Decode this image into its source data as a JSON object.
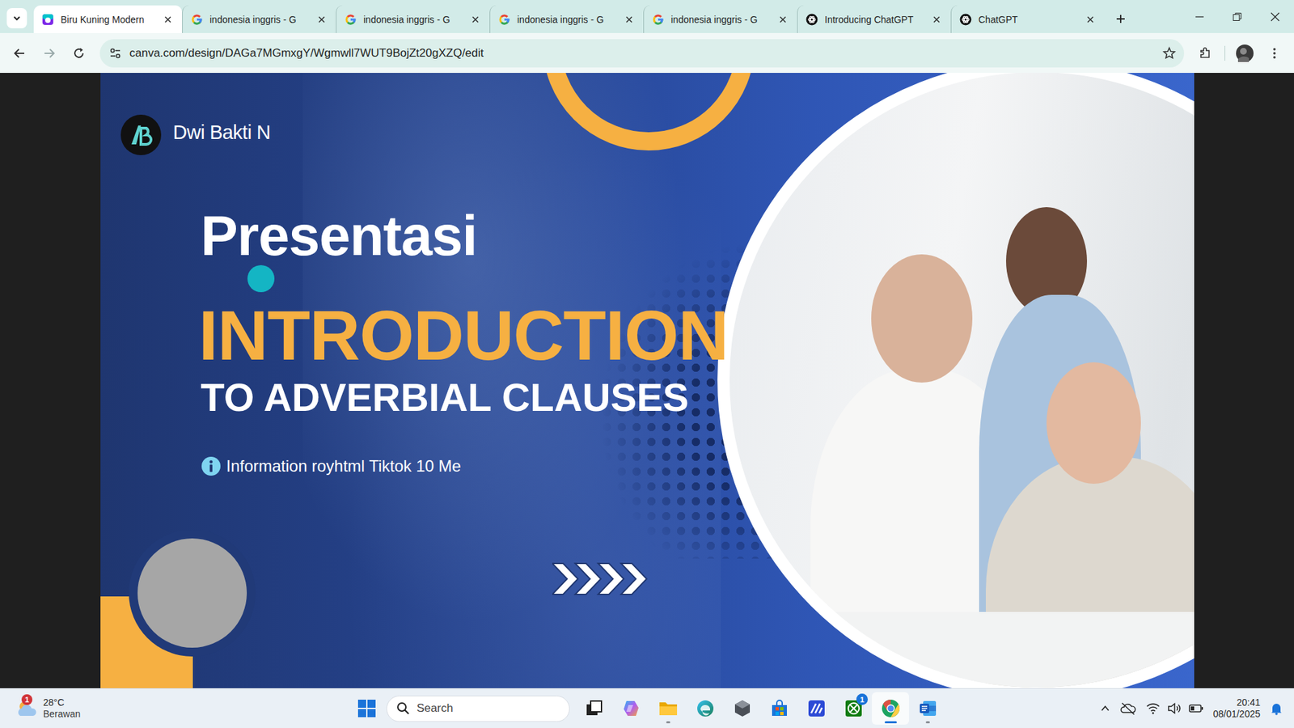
{
  "browser": {
    "tabs": [
      {
        "label": "Biru Kuning Modern",
        "selected": true,
        "kind": "canva"
      },
      {
        "label": "indonesia inggris - G",
        "selected": false,
        "kind": "google"
      },
      {
        "label": "indonesia inggris - G",
        "selected": false,
        "kind": "google"
      },
      {
        "label": "indonesia inggris - G",
        "selected": false,
        "kind": "google"
      },
      {
        "label": "indonesia inggris - G",
        "selected": false,
        "kind": "google"
      },
      {
        "label": "Introducing ChatGPT",
        "selected": false,
        "kind": "openai"
      },
      {
        "label": "ChatGPT",
        "selected": false,
        "kind": "openai"
      }
    ],
    "address": "canva.com/design/DAGa7MGmxgY/Wgmwll7WUT9BojZt20gXZQ/edit"
  },
  "slide": {
    "author": "Dwi Bakti N",
    "kicker": "Presentasi",
    "title": "INTRODUCTION",
    "subtitle": "TO ADVERBIAL CLAUSES",
    "info": "Information royhtml Tiktok 10 Me"
  },
  "taskbar": {
    "weather": {
      "temp": "28°C",
      "condition": "Berawan",
      "badge": "1"
    },
    "search": {
      "placeholder": "Search"
    },
    "apps": [
      {
        "kind": "taskview",
        "running": false,
        "active": false
      },
      {
        "kind": "copilot",
        "running": false,
        "active": false
      },
      {
        "kind": "explorer",
        "running": true,
        "active": false
      },
      {
        "kind": "edge",
        "running": false,
        "active": false
      },
      {
        "kind": "hexagon",
        "running": false,
        "active": false
      },
      {
        "kind": "store",
        "running": false,
        "active": false
      },
      {
        "kind": "mapp",
        "running": false,
        "active": false
      },
      {
        "kind": "xbox",
        "running": false,
        "active": false,
        "badge": "1"
      },
      {
        "kind": "chrome",
        "running": true,
        "active": true
      },
      {
        "kind": "word",
        "running": true,
        "active": false
      }
    ],
    "clock": {
      "time": "20:41",
      "date": "08/01/2025"
    }
  }
}
